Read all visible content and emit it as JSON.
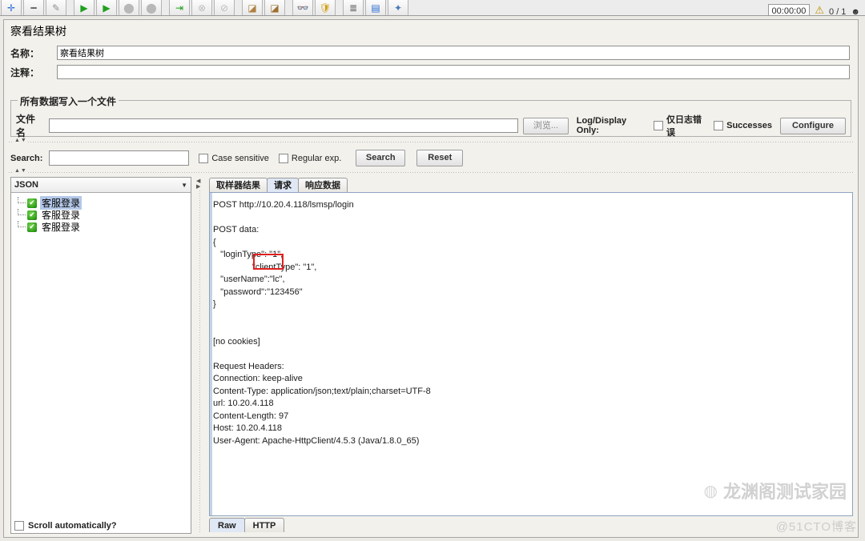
{
  "toolbar": {
    "buttons": [
      {
        "name": "add-icon",
        "glyph": "✛"
      },
      {
        "name": "remove-icon",
        "glyph": "━"
      },
      {
        "name": "edit-icon",
        "glyph": "✎"
      },
      {
        "name": "start-icon",
        "glyph": "▶"
      },
      {
        "name": "start-no-pauses-icon",
        "glyph": "▶"
      },
      {
        "name": "stop-icon",
        "glyph": "⏹"
      },
      {
        "name": "shutdown-icon",
        "glyph": "⏻"
      },
      {
        "name": "remote-start-icon",
        "glyph": "⇥"
      },
      {
        "name": "remote-stop-icon",
        "glyph": "⊗"
      },
      {
        "name": "remote-shutdown-icon",
        "glyph": "⊘"
      },
      {
        "name": "clear-icon",
        "glyph": "🧹"
      },
      {
        "name": "clear-all-icon",
        "glyph": "🧽"
      },
      {
        "name": "search-icon",
        "glyph": "👓"
      },
      {
        "name": "reset-search-icon",
        "glyph": "🛡"
      },
      {
        "name": "function-helper-icon",
        "glyph": "≣"
      },
      {
        "name": "help-icon",
        "glyph": "ℹ"
      },
      {
        "name": "templates-icon",
        "glyph": "✈"
      }
    ],
    "timer": "00:00:00",
    "warning_glyph": "⚠",
    "thread_count": "0 / 1",
    "status_glyph": "☻"
  },
  "panel": {
    "title": "察看结果树",
    "name_label": "名称：",
    "name_value": "察看结果树",
    "comment_label": "注释：",
    "comment_value": ""
  },
  "filegroup": {
    "title": "所有数据写入一个文件",
    "filename_label": "文件名",
    "filename_value": "",
    "browse_button": "浏览...",
    "log_display_label": "Log/Display Only:",
    "errors_only_label": "仅日志错误",
    "errors_only_checked": false,
    "successes_label": "Successes",
    "successes_checked": false,
    "configure_button": "Configure"
  },
  "search": {
    "label": "Search:",
    "value": "",
    "case_sensitive_label": "Case sensitive",
    "case_sensitive_checked": false,
    "regular_exp_label": "Regular exp.",
    "regular_exp_checked": false,
    "search_button": "Search",
    "reset_button": "Reset"
  },
  "tree": {
    "render_selector": "JSON",
    "nodes": [
      {
        "label": "客服登录",
        "status": "success",
        "selected": true
      },
      {
        "label": "客服登录",
        "status": "success",
        "selected": false
      },
      {
        "label": "客服登录",
        "status": "success",
        "selected": false
      }
    ],
    "scroll_automatically_label": "Scroll automatically?",
    "scroll_automatically_checked": false
  },
  "result_tabs": [
    {
      "label": "取样器结果",
      "active": false
    },
    {
      "label": "请求",
      "active": true
    },
    {
      "label": "响应数据",
      "active": false
    }
  ],
  "request": {
    "body": "POST http://10.20.4.118/lsmsp/login\n\nPOST data:\n{\n   \"loginType\": \"1\",\n                \"clientType\": \"1\",\n   \"userName\":\"lc\",\n   \"password\":\"123456\"\n}\n\n\n[no cookies]\n\nRequest Headers:\nConnection: keep-alive\nContent-Type: application/json;text/plain;charset=UTF-8\nurl: 10.20.4.118\nContent-Length: 97\nHost: 10.20.4.118\nUser-Agent: Apache-HttpClient/4.5.3 (Java/1.8.0_65)"
  },
  "view_tabs": [
    {
      "label": "Raw",
      "active": true
    },
    {
      "label": "HTTP",
      "active": false
    }
  ],
  "annotation": {
    "highlight_color": "#e02020",
    "highlight_target": "\"userName\":\"lc\","
  },
  "watermark": {
    "icon": "◍",
    "text": "龙渊阁测试家园",
    "sub": "@51CTO博客"
  }
}
